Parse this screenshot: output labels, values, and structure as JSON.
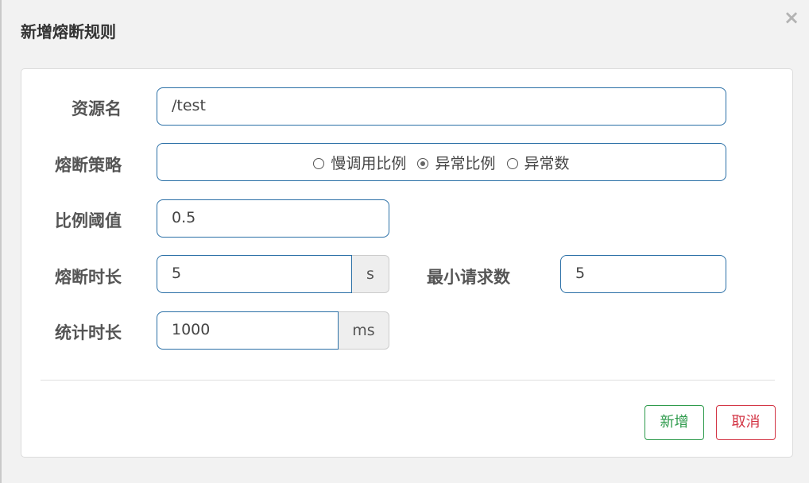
{
  "dialog": {
    "title": "新增熔断规则",
    "close_label": "×"
  },
  "form": {
    "resource": {
      "label": "资源名",
      "value": "/test"
    },
    "strategy": {
      "label": "熔断策略",
      "options": [
        {
          "label": "慢调用比例",
          "checked": false
        },
        {
          "label": "异常比例",
          "checked": true
        },
        {
          "label": "异常数",
          "checked": false
        }
      ]
    },
    "ratio": {
      "label": "比例阈值",
      "value": "0.5"
    },
    "duration": {
      "label": "熔断时长",
      "value": "5",
      "unit": "s"
    },
    "min_request": {
      "label": "最小请求数",
      "value": "5"
    },
    "stat_interval": {
      "label": "统计时长",
      "value": "1000",
      "unit": "ms"
    }
  },
  "buttons": {
    "add": "新增",
    "cancel": "取消"
  },
  "colors": {
    "accent_green": "#2d9a4b",
    "accent_red": "#d33545",
    "field_border": "#2a6fa6"
  }
}
